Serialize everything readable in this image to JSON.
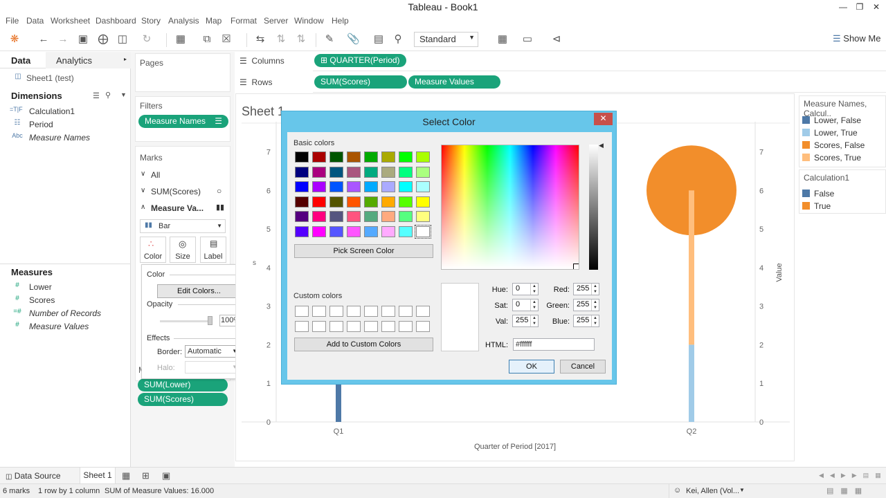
{
  "window": {
    "title": "Tableau - Book1"
  },
  "menu": [
    "File",
    "Data",
    "Worksheet",
    "Dashboard",
    "Story",
    "Analysis",
    "Map",
    "Format",
    "Server",
    "Window",
    "Help"
  ],
  "toolbar": {
    "fit_select": "Standard",
    "show_me": "Show Me"
  },
  "data_pane": {
    "tabs": {
      "data": "Data",
      "analytics": "Analytics"
    },
    "datasource": "Sheet1 (test)",
    "dimensions_title": "Dimensions",
    "dimensions": [
      {
        "icon": "=T|F",
        "label": "Calculation1"
      },
      {
        "icon": "calendar-icon",
        "label": "Period"
      },
      {
        "icon": "Abc",
        "label": "Measure Names"
      }
    ],
    "measures_title": "Measures",
    "measures": [
      {
        "icon": "#",
        "label": "Lower"
      },
      {
        "icon": "#",
        "label": "Scores"
      },
      {
        "icon": "=#",
        "label": "Number of Records"
      },
      {
        "icon": "#",
        "label": "Measure Values"
      }
    ]
  },
  "cards": {
    "pages": "Pages",
    "filters": "Filters",
    "filter_pill": "Measure Names",
    "marks": "Marks",
    "marks_all": "All",
    "marks_sum_scores": "SUM(Scores)",
    "marks_measure_values": "Measure Va...",
    "mark_type": "Bar",
    "mark_buttons": {
      "color": "Color",
      "size": "Size",
      "label": "Label"
    },
    "measure_values_letter": "M",
    "mv_pills": [
      "SUM(Lower)",
      "SUM(Scores)"
    ]
  },
  "color_popup": {
    "color_title": "Color",
    "edit_colors": "Edit Colors...",
    "opacity_title": "Opacity",
    "opacity_value": "100%",
    "effects_title": "Effects",
    "border_label": "Border:",
    "border_value": "Automatic",
    "halo_label": "Halo:"
  },
  "shelves": {
    "columns_label": "Columns",
    "rows_label": "Rows",
    "columns_pill": "QUARTER(Period)",
    "rows_pills": [
      "SUM(Scores)",
      "Measure Values"
    ]
  },
  "sheet": {
    "title": "Sheet 1",
    "x_axis_title": "Quarter of Period [2017]",
    "right_axis_title": "Value",
    "left_axis_letter": "s"
  },
  "chart_data": {
    "type": "bar",
    "categories": [
      "Q1",
      "Q2"
    ],
    "y_ticks": [
      0,
      1,
      2,
      3,
      4,
      5,
      6,
      7
    ],
    "ylim": [
      0,
      7.6
    ],
    "series": [
      {
        "name": "Lower, False",
        "values": [
          2.0,
          null
        ]
      },
      {
        "name": "Lower, True",
        "values": [
          null,
          2.0
        ]
      },
      {
        "name": "Scores, True",
        "values": [
          null,
          6.0
        ]
      },
      {
        "name": "Scores, False",
        "values": [
          null,
          6.0
        ]
      }
    ],
    "colors": [
      "#4e79a7",
      "#a0cbe8",
      "#ffbe7d",
      "#f28e2b"
    ],
    "xlabel": "Quarter of Period [2017]",
    "ylabel": "Value"
  },
  "legends": {
    "measure_names_title": "Measure Names, Calcul..",
    "measure_items": [
      {
        "label": "Lower, False",
        "color": "#4e79a7"
      },
      {
        "label": "Lower, True",
        "color": "#a0cbe8"
      },
      {
        "label": "Scores, False",
        "color": "#f28e2b"
      },
      {
        "label": "Scores, True",
        "color": "#ffbe7d"
      }
    ],
    "calc_title": "Calculation1",
    "calc_items": [
      {
        "label": "False",
        "color": "#4e79a7"
      },
      {
        "label": "True",
        "color": "#f28e2b"
      }
    ]
  },
  "dialog": {
    "title": "Select Color",
    "basic_colors_label": "Basic colors",
    "basic_colors": [
      "#000000",
      "#aa0000",
      "#005500",
      "#aa5500",
      "#00aa00",
      "#aaaa00",
      "#00ff00",
      "#aaff00",
      "#00007f",
      "#aa007f",
      "#00557f",
      "#aa557f",
      "#00aa7f",
      "#aaaa7f",
      "#00ff7f",
      "#aaff7f",
      "#0000ff",
      "#aa00ff",
      "#0055ff",
      "#aa55ff",
      "#00aaff",
      "#aaaaff",
      "#00ffff",
      "#aaffff",
      "#550000",
      "#ff0000",
      "#555500",
      "#ff5500",
      "#55aa00",
      "#ffaa00",
      "#55ff00",
      "#ffff00",
      "#55007f",
      "#ff007f",
      "#55557f",
      "#ff557f",
      "#55aa7f",
      "#ffaa7f",
      "#55ff7f",
      "#ffff7f",
      "#5500ff",
      "#ff00ff",
      "#5555ff",
      "#ff55ff",
      "#55aaff",
      "#ffaaff",
      "#55ffff",
      "#ffffff"
    ],
    "pick_screen": "Pick Screen Color",
    "custom_colors_label": "Custom colors",
    "add_custom": "Add to Custom Colors",
    "hue_label": "Hue:",
    "hue": "0",
    "sat_label": "Sat:",
    "sat": "0",
    "val_label": "Val:",
    "val": "255",
    "red_label": "Red:",
    "red": "255",
    "green_label": "Green:",
    "green": "255",
    "blue_label": "Blue:",
    "blue": "255",
    "html_label": "HTML:",
    "html": "#ffffff",
    "ok": "OK",
    "cancel": "Cancel",
    "close": "✕"
  },
  "tabs": {
    "data_source": "Data Source",
    "sheet": "Sheet 1"
  },
  "status": {
    "marks": "6 marks",
    "rows": "1 row by 1 column",
    "sum": "SUM of Measure Values: 16.000",
    "user": "Kei, Allen (Vol..."
  }
}
